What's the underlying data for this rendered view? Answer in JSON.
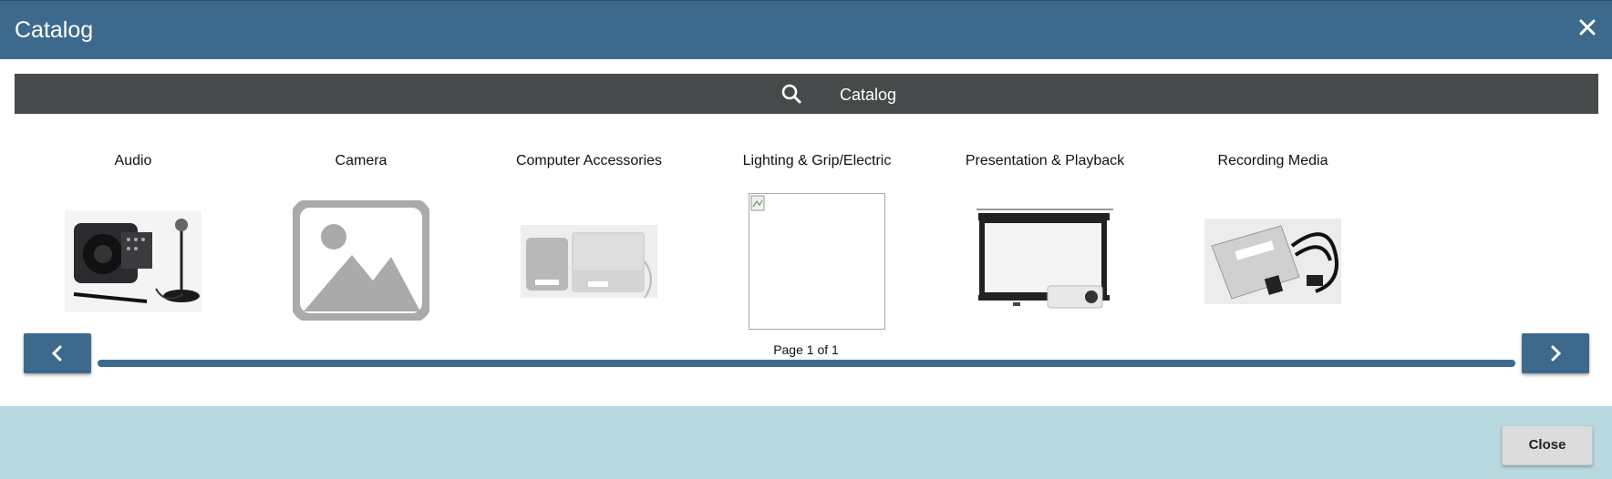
{
  "window": {
    "title": "Catalog"
  },
  "search": {
    "label": "Catalog"
  },
  "catalog": {
    "items": [
      {
        "label": "Audio",
        "image": "speaker-mixer-photo"
      },
      {
        "label": "Camera",
        "image": "placeholder-image-icon"
      },
      {
        "label": "Computer Accessories",
        "image": "external-drive-photo"
      },
      {
        "label": "Lighting & Grip/Electric",
        "image": "broken-image"
      },
      {
        "label": "Presentation & Playback",
        "image": "projector-screen-photo"
      },
      {
        "label": "Recording Media",
        "image": "card-reader-photo"
      }
    ]
  },
  "pagination": {
    "label": "Page 1 of 1"
  },
  "footer": {
    "close_label": "Close"
  },
  "colors": {
    "header": "#3d6a8c",
    "searchbar": "#464a4b",
    "footer": "#b8d8e0"
  }
}
